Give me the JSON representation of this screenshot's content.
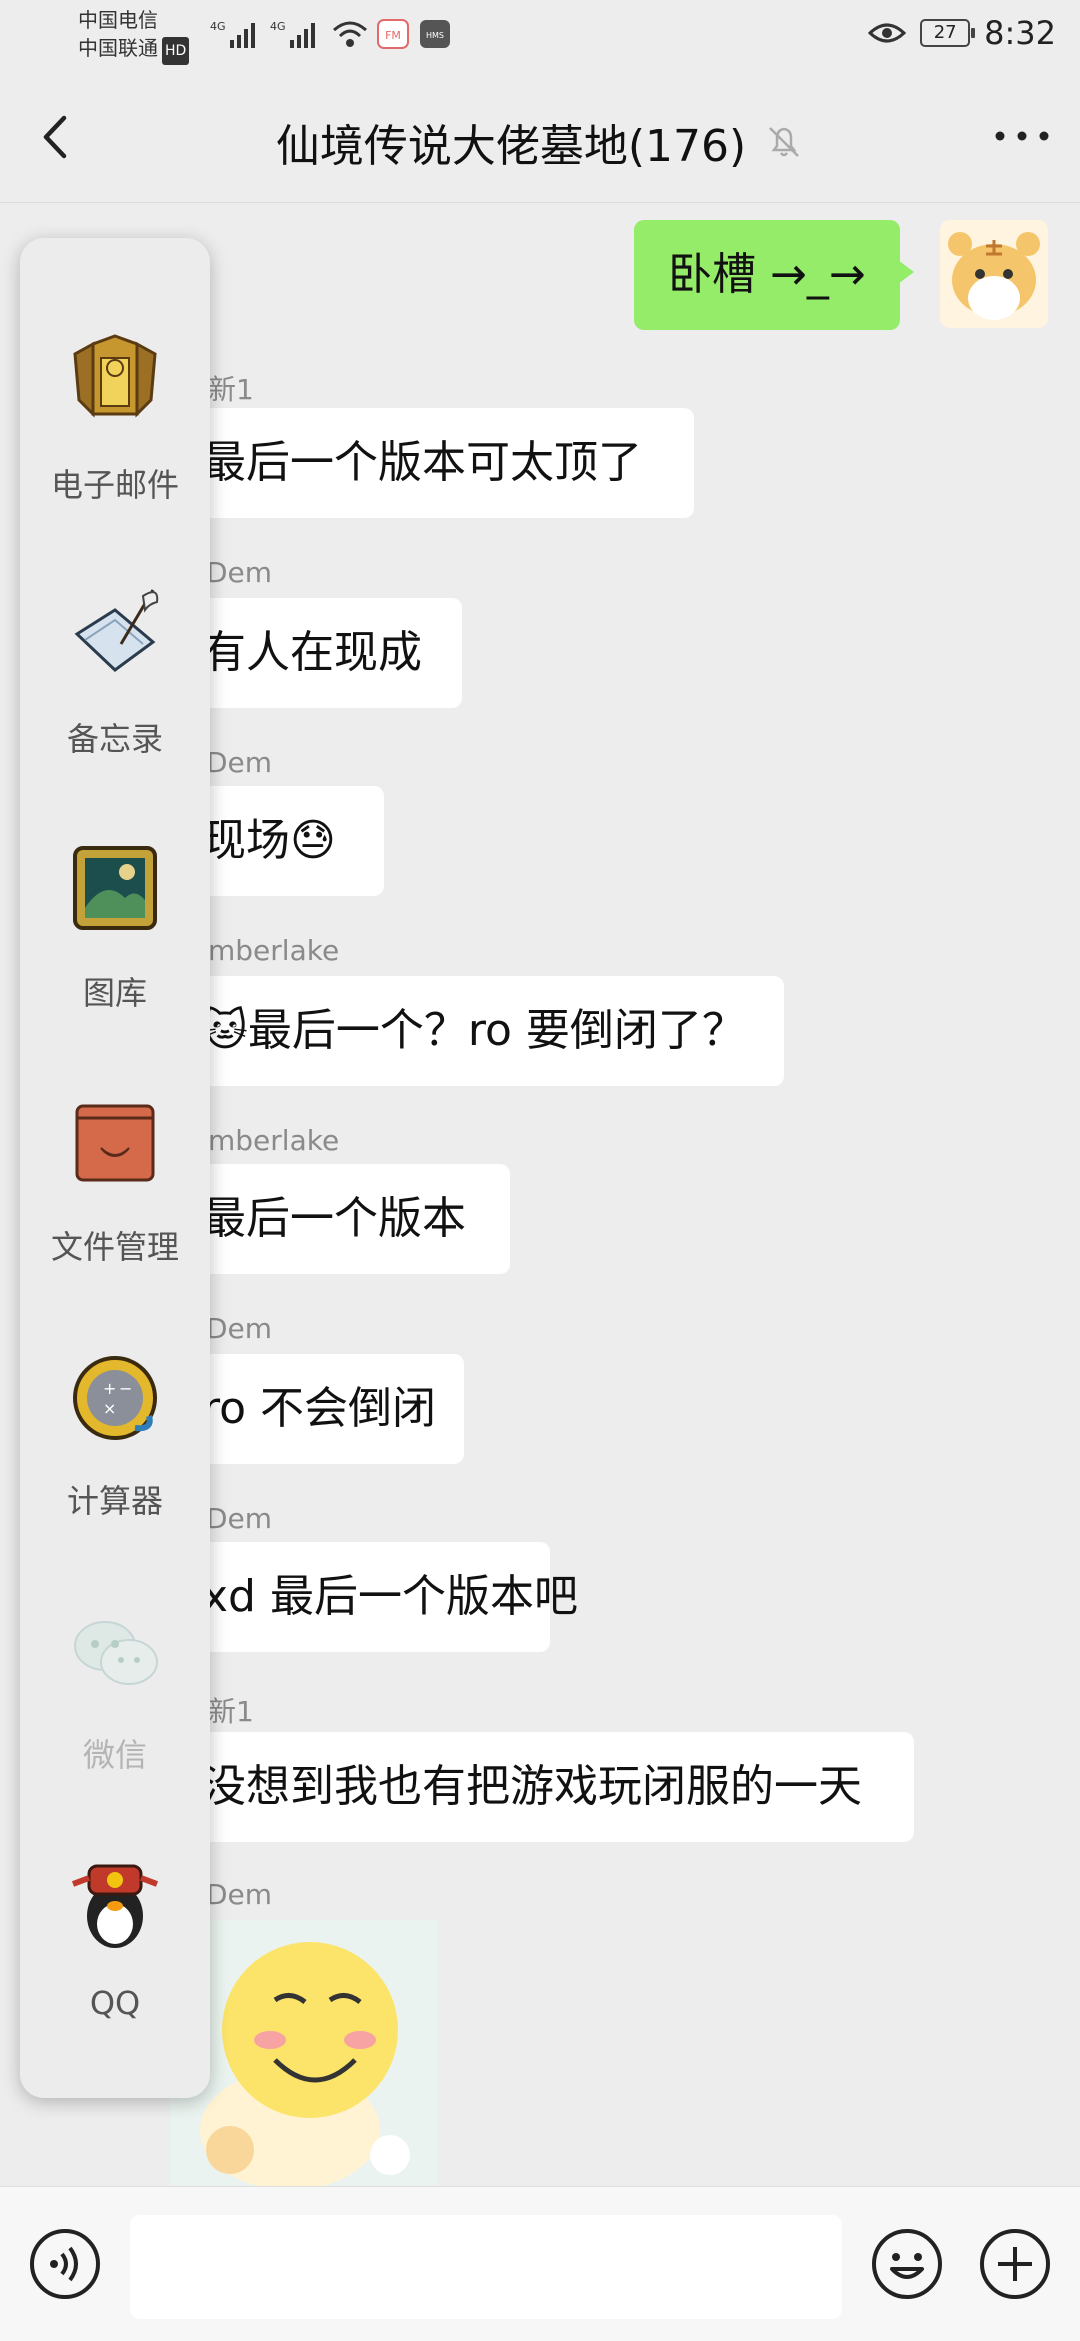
{
  "status_bar": {
    "carrier_1": "中国电信",
    "carrier_2": "中国联通",
    "hd_badge": "HD",
    "network_1": "4G",
    "network_2": "4G",
    "fm_icon_text": "FM",
    "hms_icon_text": "HMS",
    "battery": "27",
    "time": "8:32"
  },
  "header": {
    "title": "仙境传说大佬墓地(176)",
    "icons": [
      "back-icon",
      "mute-bell-icon",
      "more-icon"
    ]
  },
  "my_message": {
    "text": "卧槽 →_→"
  },
  "messages": [
    {
      "sender": "新1",
      "text": "最后一个版本可太顶了"
    },
    {
      "sender": "Dem",
      "text": "有人在现成"
    },
    {
      "sender": "Dem",
      "text": "现场😓"
    },
    {
      "sender": "mberlake",
      "text": "🐱最后一个？ro 要倒闭了？"
    },
    {
      "sender": "mberlake",
      "text": "最后一个版本"
    },
    {
      "sender": "Dem",
      "text": "ro 不会倒闭"
    },
    {
      "sender": "Dem",
      "text": "xd 最后一个版本吧"
    },
    {
      "sender": "新1",
      "text": "没想到我也有把游戏玩闭服的一天"
    },
    {
      "sender": "Dem",
      "text": ""
    }
  ],
  "dock": [
    {
      "label": "电子邮件",
      "icon": "mail-icon"
    },
    {
      "label": "备忘录",
      "icon": "memo-icon"
    },
    {
      "label": "图库",
      "icon": "gallery-icon"
    },
    {
      "label": "文件管理",
      "icon": "files-icon"
    },
    {
      "label": "计算器",
      "icon": "calculator-icon"
    },
    {
      "label": "微信",
      "icon": "wechat-icon"
    },
    {
      "label": "QQ",
      "icon": "qq-icon"
    }
  ],
  "input_bar": {
    "icons": [
      "voice-icon",
      "emoji-icon",
      "plus-icon"
    ],
    "text_value": ""
  }
}
